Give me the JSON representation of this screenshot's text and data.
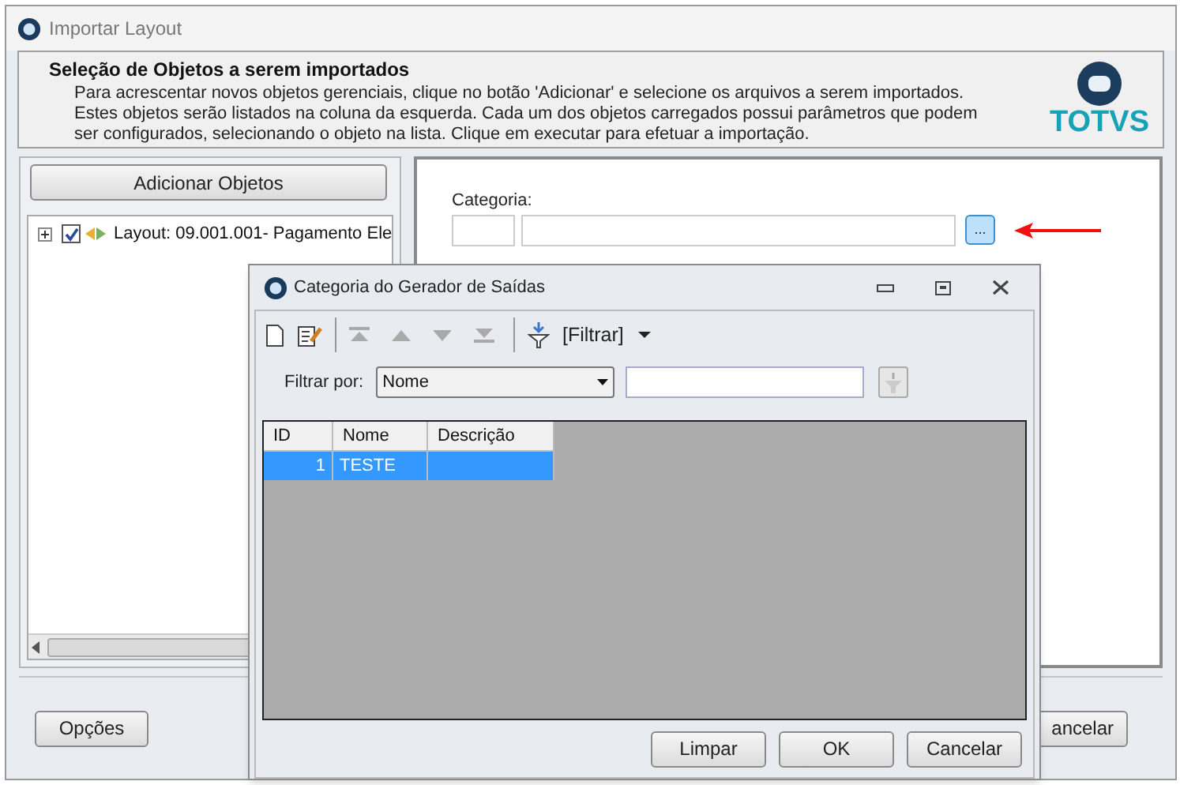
{
  "window": {
    "title": "Importar Layout"
  },
  "header": {
    "title": "Seleção de Objetos a serem importados",
    "description": "Para acrescentar novos objetos gerenciais, clique no botão 'Adicionar' e selecione os arquivos a serem importados. Estes objetos serão listados na coluna da esquerda. Cada um dos objetos carregados possui parâmetros que podem ser configurados, selecionando o objeto na lista. Clique em executar para efetuar a importação.",
    "logo": "TOTVS"
  },
  "left_panel": {
    "add_button": "Adicionar Objetos",
    "tree": [
      {
        "label": "Layout: 09.001.001- Pagamento Ele",
        "checked": true,
        "expanded": false
      }
    ]
  },
  "right_panel": {
    "category_label": "Categoria:",
    "lookup_button": "..."
  },
  "footer": {
    "options_button": "Opções",
    "cancel_button": "ancelar"
  },
  "dialog": {
    "title": "Categoria do Gerador de Saídas",
    "filter_menu": "[Filtrar]",
    "filter_label": "Filtrar por:",
    "filter_field": "Nome",
    "table": {
      "columns": [
        "ID",
        "Nome",
        "Descrição"
      ],
      "rows": [
        {
          "cells": [
            "1",
            "TESTE",
            ""
          ],
          "selected": true
        }
      ]
    },
    "buttons": [
      "Limpar",
      "OK",
      "Cancelar"
    ]
  }
}
